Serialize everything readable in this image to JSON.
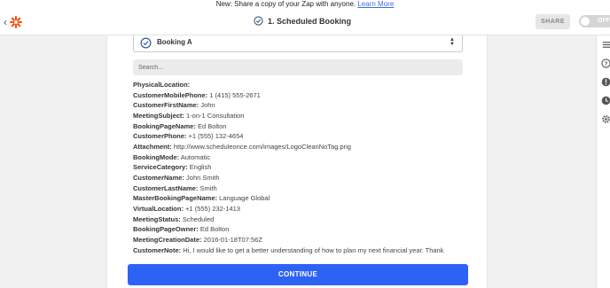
{
  "banner": {
    "text": "New: Share a copy of your Zap with anyone.",
    "link": "Learn More"
  },
  "topbar": {
    "title": "1. Scheduled Booking",
    "share_label": "SHARE",
    "toggle_label": "OFF",
    "accent": "#ff4a00"
  },
  "select": {
    "value": "Booking A"
  },
  "search": {
    "placeholder": "Search..."
  },
  "fields": [
    {
      "key": "PhysicalLocation:",
      "value": ""
    },
    {
      "key": "CustomerMobilePhone:",
      "value": "1 (415) 555-2671"
    },
    {
      "key": "CustomerFirstName:",
      "value": "John"
    },
    {
      "key": "MeetingSubject:",
      "value": "1-on-1 Consultation"
    },
    {
      "key": "BookingPageName:",
      "value": "Ed Bolton"
    },
    {
      "key": "CustomerPhone:",
      "value": "+1 (555) 132-4654"
    },
    {
      "key": "Attachment:",
      "value": "http://www.scheduleonce.com/images/LogoCleanNoTag.png"
    },
    {
      "key": "BookingMode:",
      "value": "Automatic"
    },
    {
      "key": "ServiceCategory:",
      "value": "English"
    },
    {
      "key": "CustomerName:",
      "value": "John Smith"
    },
    {
      "key": "CustomerLastName:",
      "value": "Smith"
    },
    {
      "key": "MasterBookingPageName:",
      "value": "Language Global"
    },
    {
      "key": "VirtualLocation:",
      "value": "+1 (555) 232-1413"
    },
    {
      "key": "MeetingStatus:",
      "value": "Scheduled"
    },
    {
      "key": "BookingPageOwner:",
      "value": "Ed Bolton"
    },
    {
      "key": "MeetingCreationDate:",
      "value": "2016-01-18T07:56Z"
    },
    {
      "key": "CustomerNote:",
      "value": "Hi, I would like to get a better understanding of how to plan my next financial year. Thank"
    }
  ],
  "continue_label": "CONTINUE",
  "icons": {
    "back": "chevron-left-icon",
    "logo": "zapier-logo-icon",
    "step": "clock-icon",
    "rightbar": [
      "list-icon",
      "help-icon",
      "alert-icon",
      "history-icon",
      "settings-icon"
    ]
  },
  "colors": {
    "primary": "#2d63f5",
    "brand": "#ff4a00"
  }
}
